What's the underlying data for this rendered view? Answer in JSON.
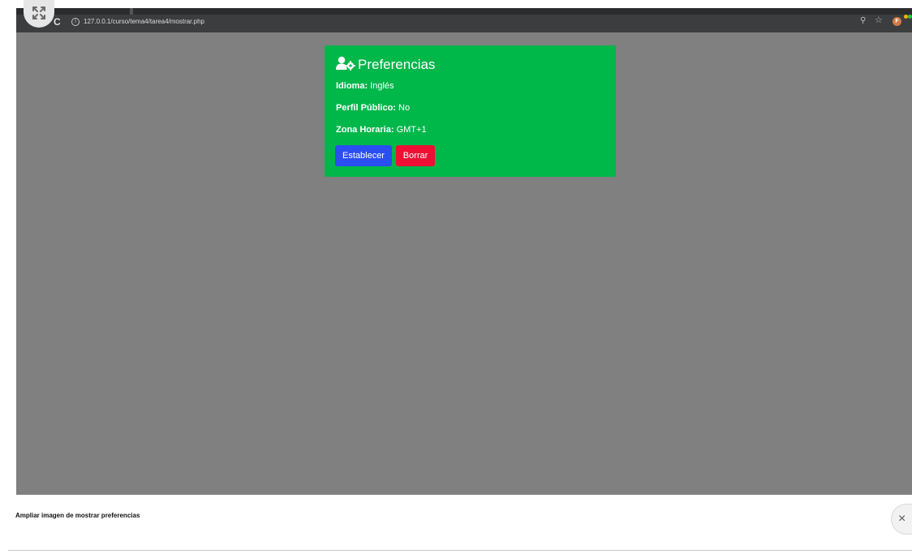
{
  "browser": {
    "url": "127.0.0.1/curso/tema4/tarea4/mostrar.php",
    "profile_initial": "F"
  },
  "card": {
    "title": "Preferencias",
    "rows": [
      {
        "label": "Idioma:",
        "value": "Inglés"
      },
      {
        "label": "Perfil Público:",
        "value": "No"
      },
      {
        "label": "Zona Horaria:",
        "value": "GMT+1"
      }
    ],
    "buttons": {
      "set": "Establecer",
      "delete": "Borrar"
    },
    "colors": {
      "background": "#00b74a",
      "set_button": "#2a4ef0",
      "delete_button": "#ef0f35"
    }
  },
  "viewer": {
    "caption": "Ampliar imagen de mostrar preferencias",
    "close_symbol": "×"
  }
}
